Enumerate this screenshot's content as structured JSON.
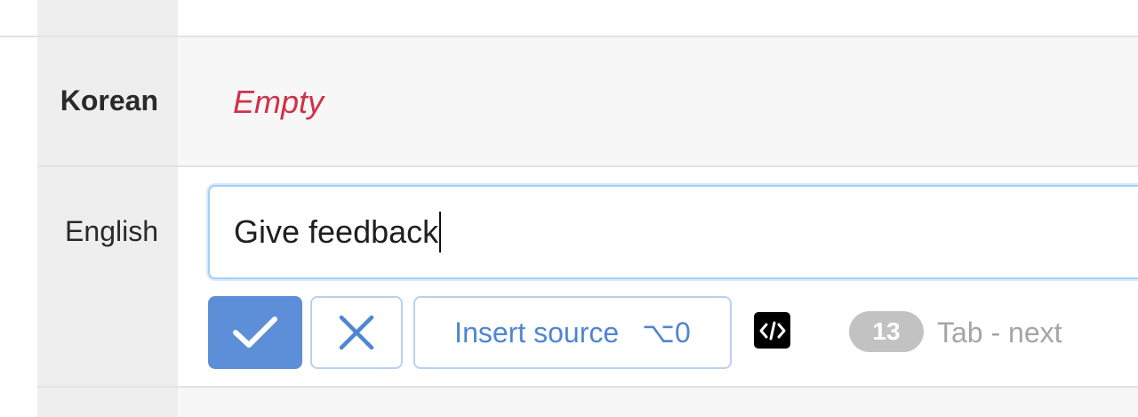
{
  "rows": {
    "korean": {
      "label": "Korean",
      "value_placeholder": "Empty"
    },
    "english": {
      "label": "English",
      "value": "Give feedback"
    }
  },
  "toolbar": {
    "save_icon": "check-icon",
    "cancel_icon": "close-icon",
    "insert_source_label": "Insert source",
    "insert_source_shortcut": "⌥0",
    "code_icon": "code-icon",
    "char_count": "13",
    "tab_hint": "Tab - next"
  },
  "colors": {
    "accent": "#5d8fd8",
    "empty": "#d0314a",
    "focus_border": "#a8d0f2"
  }
}
